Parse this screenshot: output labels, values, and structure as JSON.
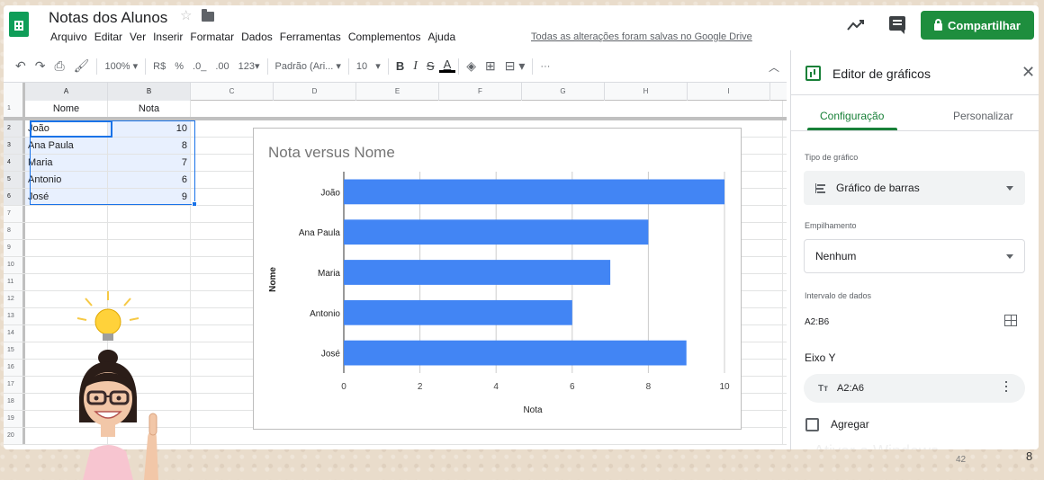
{
  "app": {
    "doc_title": "Notas dos Alunos",
    "menu": [
      "Arquivo",
      "Editar",
      "Ver",
      "Inserir",
      "Formatar",
      "Dados",
      "Ferramentas",
      "Complementos",
      "Ajuda"
    ],
    "save_status": "Todas as alterações foram salvas no Google Drive",
    "share_label": "Compartilhar",
    "brand_color": "#1e8e3e"
  },
  "toolbar": {
    "zoom": "100%",
    "currency": "R$",
    "percent": "%",
    "dec_less": ".0_",
    "dec_more": ".00",
    "format_more": "123",
    "font": "Padrão (Ari...",
    "font_size": "10",
    "bold": "B",
    "italic": "I",
    "strike": "S",
    "text_color": "A",
    "more": "···"
  },
  "sheet": {
    "columns": [
      "A",
      "B",
      "C",
      "D",
      "E",
      "F",
      "G",
      "H",
      "I"
    ],
    "row_numbers": [
      "1",
      "2",
      "3",
      "4",
      "5",
      "6",
      "7",
      "8",
      "9",
      "10",
      "11",
      "12",
      "13",
      "14",
      "15",
      "16",
      "17",
      "18",
      "19",
      "20"
    ],
    "header": [
      "Nome",
      "Nota"
    ],
    "rows": [
      [
        "João",
        "10"
      ],
      [
        "Ana Paula",
        "8"
      ],
      [
        "Maria",
        "7"
      ],
      [
        "Antonio",
        "6"
      ],
      [
        "José",
        "9"
      ]
    ]
  },
  "chart_data": {
    "type": "bar",
    "orientation": "horizontal",
    "title": "Nota versus Nome",
    "categories": [
      "João",
      "Ana Paula",
      "Maria",
      "Antonio",
      "José"
    ],
    "values": [
      10,
      8,
      7,
      6,
      9
    ],
    "xlabel": "Nota",
    "ylabel": "Nome",
    "xlim": [
      0,
      10
    ],
    "x_ticks": [
      "0",
      "2",
      "4",
      "6",
      "8",
      "10"
    ],
    "grid": true,
    "bar_color": "#4285f4"
  },
  "editor": {
    "title": "Editor de gráficos",
    "tab_setup": "Configuração",
    "tab_customize": "Personalizar",
    "chart_type_label": "Tipo de gráfico",
    "chart_type_value": "Gráfico de barras",
    "stacking_label": "Empilhamento",
    "stacking_value": "Nenhum",
    "range_label": "Intervalo de dados",
    "range_value": "A2:B6",
    "y_axis_label": "Eixo Y",
    "y_axis_chip": "A2:A6",
    "aggregate_label": "Agregar",
    "accent_color": "#188038"
  },
  "footer": {
    "watermark": "Ativar o Windows",
    "page_number": "42",
    "corner_number": "8"
  }
}
